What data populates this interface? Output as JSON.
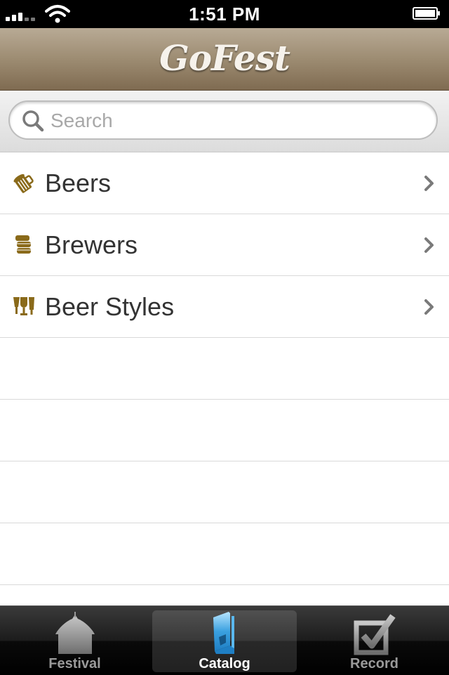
{
  "status_bar": {
    "time": "1:51 PM"
  },
  "nav": {
    "title": "GoFest"
  },
  "search": {
    "placeholder": "Search",
    "value": ""
  },
  "list": {
    "items": [
      {
        "label": "Beers",
        "icon": "beer-mug-icon"
      },
      {
        "label": "Brewers",
        "icon": "barrel-icon"
      },
      {
        "label": "Beer Styles",
        "icon": "glasses-icon"
      }
    ]
  },
  "tabs": [
    {
      "label": "Festival",
      "icon": "tent-icon",
      "selected": false
    },
    {
      "label": "Catalog",
      "icon": "book-icon",
      "selected": true
    },
    {
      "label": "Record",
      "icon": "checkbox-icon",
      "selected": false
    }
  ],
  "colors": {
    "accent_brown": "#8a6a1a",
    "nav_bg": "#9d8c72",
    "tab_selected_blue": "#3aa0e0"
  }
}
